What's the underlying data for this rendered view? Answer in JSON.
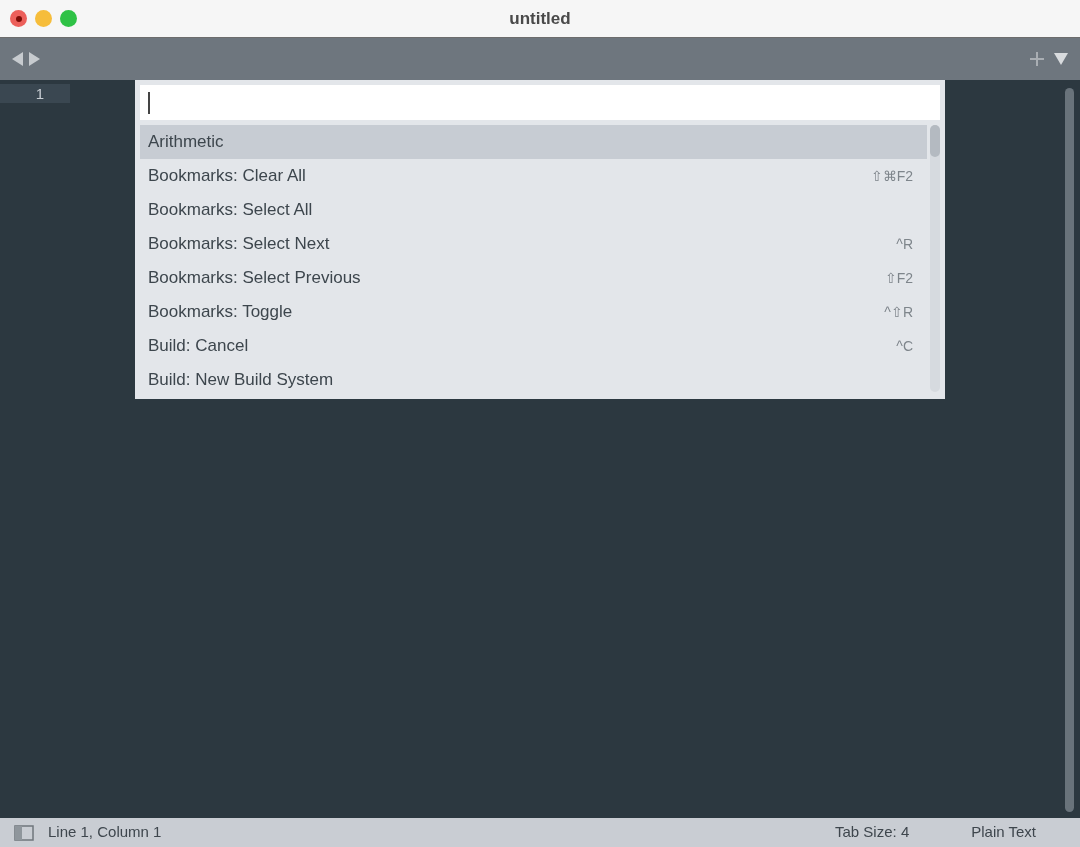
{
  "window": {
    "title": "untitled"
  },
  "gutter": {
    "line_numbers": [
      "1"
    ]
  },
  "command_palette": {
    "items": [
      {
        "label": "Arithmetic",
        "selected": true
      },
      {
        "label": "Bookmarks: Clear All",
        "shortcut": "⇧⌘F2",
        "selected": false
      },
      {
        "label": "Bookmarks: Select All",
        "selected": false
      },
      {
        "label": "Bookmarks: Select Next",
        "shortcut": "^R",
        "selected": false
      },
      {
        "label": "Bookmarks: Select Previous",
        "shortcut": "⇧F2",
        "selected": false
      },
      {
        "label": "Bookmarks: Toggle",
        "shortcut": "^⇧R",
        "selected": false
      },
      {
        "label": "Build: Cancel",
        "shortcut": "^C",
        "selected": false
      },
      {
        "label": "Build: New Build System",
        "selected": false
      }
    ]
  },
  "status_bar": {
    "position": "Line 1, Column 1",
    "tab_size": "Tab Size: 4",
    "syntax": "Plain Text"
  }
}
